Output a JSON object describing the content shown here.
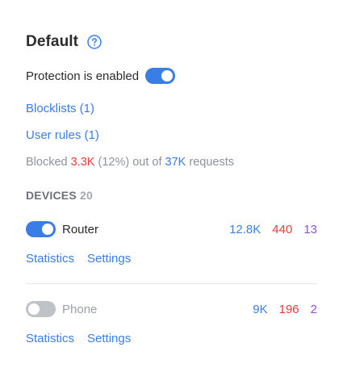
{
  "header": {
    "title": "Default",
    "help_icon": "question-circle-icon"
  },
  "protection": {
    "label": "Protection is enabled",
    "enabled": true
  },
  "links": {
    "blocklists": "Blocklists (1)",
    "user_rules": "User rules (1)"
  },
  "summary": {
    "prefix": "Blocked",
    "blocked_value": "3.3K",
    "percent": "(12%)",
    "middle": "out of",
    "total_value": "37K",
    "suffix": "requests"
  },
  "devices": {
    "heading": "DEVICES",
    "count": "20",
    "items": [
      {
        "name": "Router",
        "enabled": true,
        "stat_total": "12.8K",
        "stat_blocked": "440",
        "stat_other": "13",
        "statistics_label": "Statistics",
        "settings_label": "Settings"
      },
      {
        "name": "Phone",
        "enabled": false,
        "stat_total": "9K",
        "stat_blocked": "196",
        "stat_other": "2",
        "statistics_label": "Statistics",
        "settings_label": "Settings"
      }
    ]
  },
  "colors": {
    "accent_blue": "#3a7de6",
    "blocked_red": "#e83a3a",
    "stat_purple": "#8c4fe0",
    "toggle_off": "#bfc3c7"
  }
}
